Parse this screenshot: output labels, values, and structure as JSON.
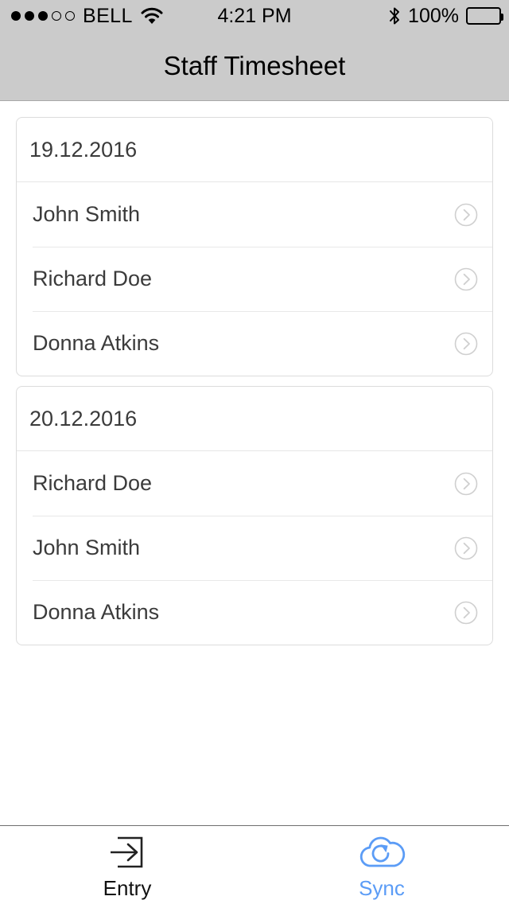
{
  "status_bar": {
    "signal_dots_filled": 3,
    "signal_dots_total": 5,
    "carrier": "BELL",
    "wifi_icon": "wifi-icon",
    "time": "4:21 PM",
    "bluetooth_icon": "bluetooth-icon",
    "battery_percent": "100%",
    "battery_level": 100
  },
  "navbar": {
    "title": "Staff Timesheet"
  },
  "colors": {
    "chrome_gray": "#cbcbcb",
    "text_dark": "#3b3b3b",
    "accent_blue": "#5b9cf6",
    "divider": "#e8e8e8",
    "card_border": "#dcdcdc"
  },
  "groups": [
    {
      "date": "19.12.2016",
      "entries": [
        {
          "name": "John Smith",
          "accessory": "chevron-right-icon"
        },
        {
          "name": "Richard Doe",
          "accessory": "chevron-right-icon"
        },
        {
          "name": "Donna Atkins",
          "accessory": "chevron-right-icon"
        }
      ]
    },
    {
      "date": "20.12.2016",
      "entries": [
        {
          "name": "Richard Doe",
          "accessory": "chevron-right-icon"
        },
        {
          "name": "John Smith",
          "accessory": "chevron-right-icon"
        },
        {
          "name": "Donna Atkins",
          "accessory": "chevron-right-icon"
        }
      ]
    }
  ],
  "tabbar": {
    "tabs": [
      {
        "label": "Entry",
        "icon": "entry-arrow-icon",
        "selected": false
      },
      {
        "label": "Sync",
        "icon": "cloud-sync-icon",
        "selected": true
      }
    ]
  }
}
